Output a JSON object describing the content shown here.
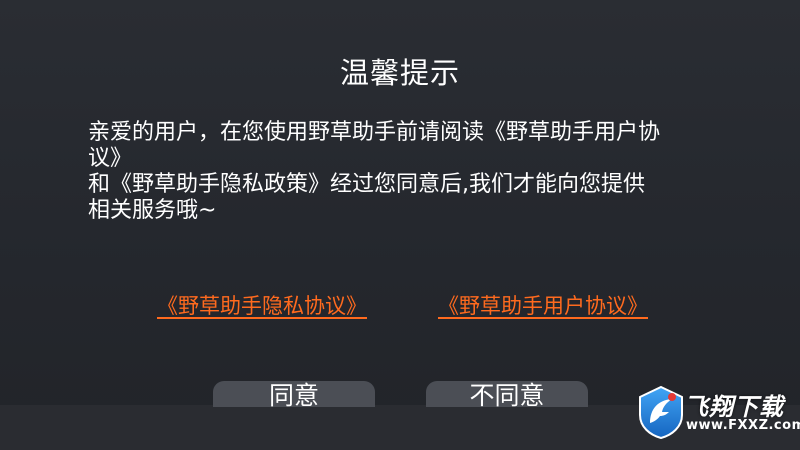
{
  "dialog": {
    "title": "温馨提示",
    "message_lines": [
      "亲爱的用户，在您使用野草助手前请阅读《野草助手用户协",
      "议》",
      "和《野草助手隐私政策》经过您同意后,我们才能向您提供",
      "相关服务哦~"
    ],
    "links": {
      "privacy": "《野草助手隐私协议》",
      "user": "《野草助手用户协议》"
    },
    "buttons": {
      "agree": "同意",
      "disagree": "不同意"
    }
  },
  "watermark": {
    "title": "飞翔下载",
    "url": "www.FXXZ.com",
    "icon": "fxxz-logo-icon"
  },
  "colors": {
    "background": "#25282f",
    "text": "#ffffff",
    "link": "#ff6a1e",
    "button": "#4b4e55",
    "logo_blue": "#1e88e5",
    "logo_red": "#e53935"
  }
}
